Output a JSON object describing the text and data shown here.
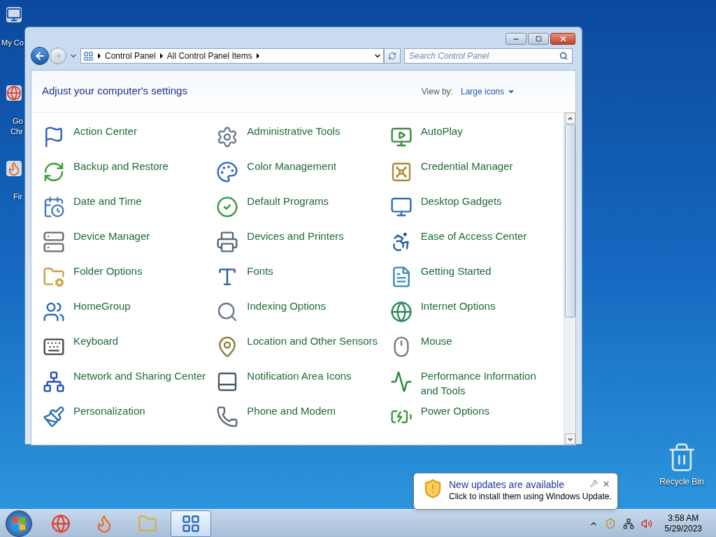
{
  "desktop_icons": [
    {
      "lines": [
        "My Co"
      ]
    },
    {
      "lines": [
        "Go",
        "Chr"
      ]
    },
    {
      "lines": [
        "Fir"
      ]
    }
  ],
  "window": {
    "address_path": [
      "Control Panel",
      "All Control Panel Items"
    ],
    "search": {
      "placeholder": "Search Control Panel"
    },
    "heading": "Adjust your computer's settings",
    "view_by": {
      "label": "View by:",
      "value": "Large icons"
    },
    "items": [
      {
        "label": "Action Center"
      },
      {
        "label": "Administrative Tools"
      },
      {
        "label": "AutoPlay"
      },
      {
        "label": "Backup and Restore"
      },
      {
        "label": "Color Management"
      },
      {
        "label": "Credential Manager"
      },
      {
        "label": "Date and Time"
      },
      {
        "label": "Default Programs"
      },
      {
        "label": "Desktop Gadgets"
      },
      {
        "label": "Device Manager"
      },
      {
        "label": "Devices and Printers"
      },
      {
        "label": "Ease of Access Center"
      },
      {
        "label": "Folder Options"
      },
      {
        "label": "Fonts"
      },
      {
        "label": "Getting Started"
      },
      {
        "label": "HomeGroup"
      },
      {
        "label": "Indexing Options"
      },
      {
        "label": "Internet Options"
      },
      {
        "label": "Keyboard"
      },
      {
        "label": "Location and Other Sensors"
      },
      {
        "label": "Mouse"
      },
      {
        "label": "Network and Sharing Center"
      },
      {
        "label": "Notification Area Icons"
      },
      {
        "label": "Performance Information and Tools"
      },
      {
        "label": "Personalization"
      },
      {
        "label": "Phone and Modem"
      },
      {
        "label": "Power Options"
      }
    ]
  },
  "recycle_bin": {
    "label": "Recycle Bin"
  },
  "notification": {
    "title": "New updates are available",
    "message": "Click to install them using Windows Update."
  },
  "taskbar": {
    "items": [
      {
        "selected": false
      },
      {
        "selected": false
      },
      {
        "selected": false
      },
      {
        "selected": true
      }
    ],
    "clock": {
      "time": "3:58 AM",
      "date": "5/29/2023"
    }
  }
}
